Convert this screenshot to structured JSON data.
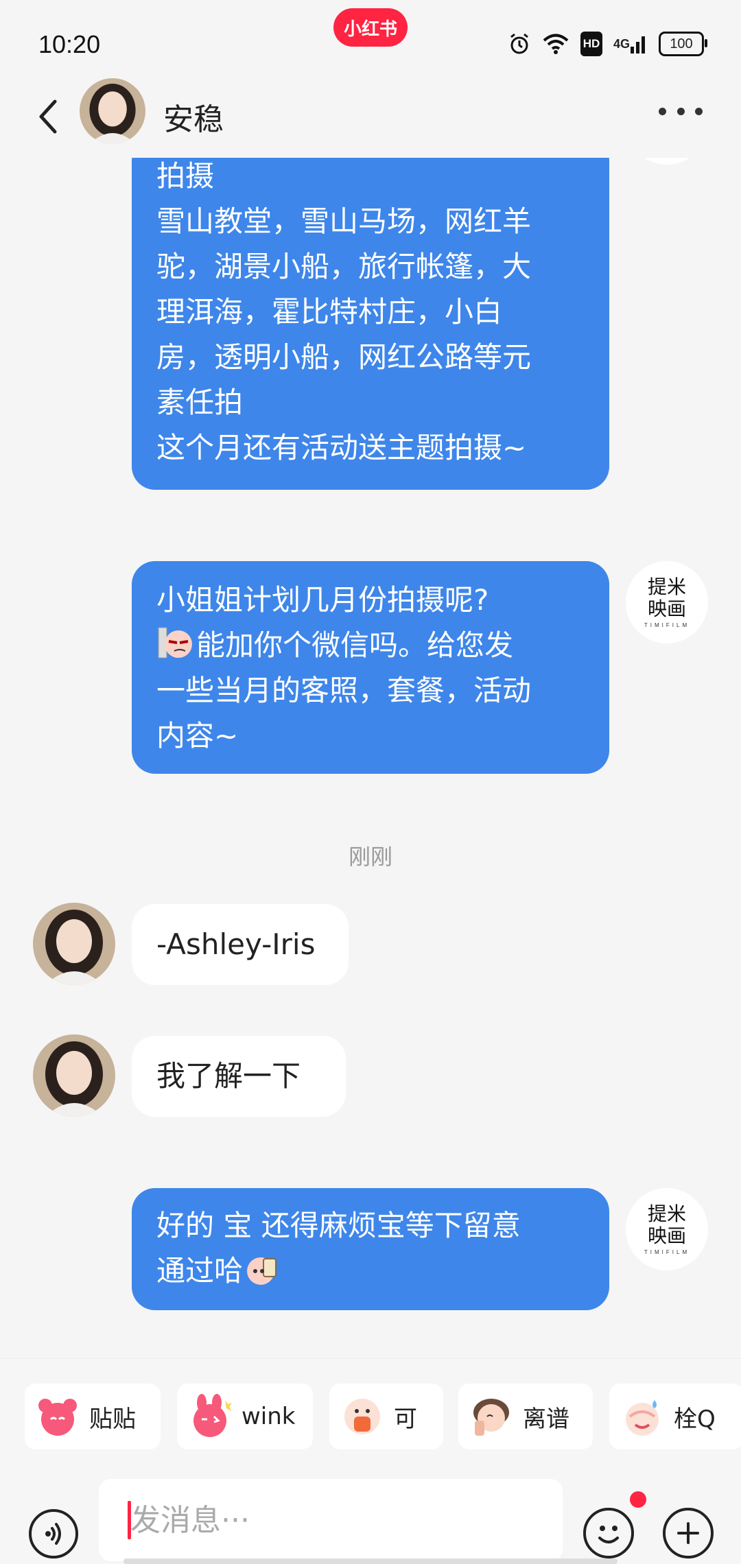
{
  "status_bar": {
    "time": "10:20",
    "app_badge": "小红书",
    "network": "4G",
    "hd": "HD",
    "battery": "100"
  },
  "header": {
    "contact_name": "安稳"
  },
  "brand_avatar": {
    "line1": "提米",
    "line2": "映画",
    "sub": "TIMIFILM"
  },
  "messages": {
    "msg1_lines": [
      "拍摄",
      "雪山教堂，雪山马场，网红羊",
      "驼，湖景小船，旅行帐篷，大",
      "理洱海，霍比特村庄，小白",
      "房，透明小船，网红公路等元",
      "素任拍",
      "这个月还有活动送主题拍摄~"
    ],
    "msg2_line1": "小姐姐计划几月份拍摄呢?",
    "msg2_line2": "能加你个微信吗。给您发",
    "msg2_line3": "一些当月的客照，套餐，活动",
    "msg2_line4": "内容~",
    "timestamp": "刚刚",
    "msg3": "-Ashley-Iris",
    "msg4": "我了解一下",
    "msg5_line1": "好的  宝  还得麻烦宝等下留意",
    "msg5_line2": "通过哈"
  },
  "quick_stickers": [
    {
      "label": "贴贴",
      "icon": "hug-sticker"
    },
    {
      "label": "wink",
      "icon": "wink-sticker"
    },
    {
      "label": "可",
      "icon": "ok-sticker"
    },
    {
      "label": "离谱",
      "icon": "facepalm-sticker"
    },
    {
      "label": "栓Q",
      "icon": "thankyou-sticker"
    }
  ],
  "input": {
    "placeholder": "发消息···"
  },
  "colors": {
    "accent": "#ff2442",
    "bubble_out": "#3e86ea",
    "background": "#f5f5f5"
  }
}
